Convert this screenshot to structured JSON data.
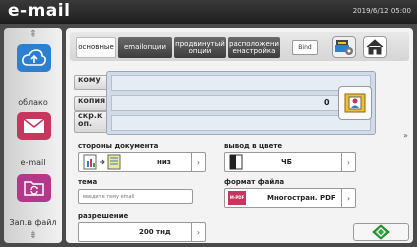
{
  "app": {
    "title": "e-mail",
    "datetime": "2019/6/12 05:00"
  },
  "sidebar": {
    "items": [
      {
        "label": "облако",
        "icon": "cloud-upload-icon"
      },
      {
        "label": "e-mail",
        "icon": "envelope-icon"
      },
      {
        "label": "Зап.в файл",
        "icon": "folder-sync-icon"
      }
    ],
    "up_arrow": "⇞",
    "down_arrow": "⇟"
  },
  "tabs": [
    "основные",
    "emailопции",
    "продвинутый опции",
    "расположени енастройка"
  ],
  "bind_label": "Bind",
  "address": {
    "to_label": "кому",
    "cc_label": "копия",
    "bcc_label": "скр.к оп.",
    "count": "0"
  },
  "more_symbol": "»",
  "document_sides": {
    "label": "стороны документа",
    "value": "низ"
  },
  "color_output": {
    "label": "вывод в цвете",
    "value": "ЧБ"
  },
  "subject": {
    "label": "тема",
    "placeholder": "введите тему email"
  },
  "file_format": {
    "label": "формат файла",
    "value": "Многостран. PDF",
    "icon_text": "M-PDF"
  },
  "resolution": {
    "label": "разрешение",
    "value": "200 тнд"
  },
  "colors": {
    "start_green": "#2fa53a",
    "accent_blue": "#2d7fd0",
    "accent_pink": "#c8365f",
    "accent_magenta": "#b4388a"
  }
}
